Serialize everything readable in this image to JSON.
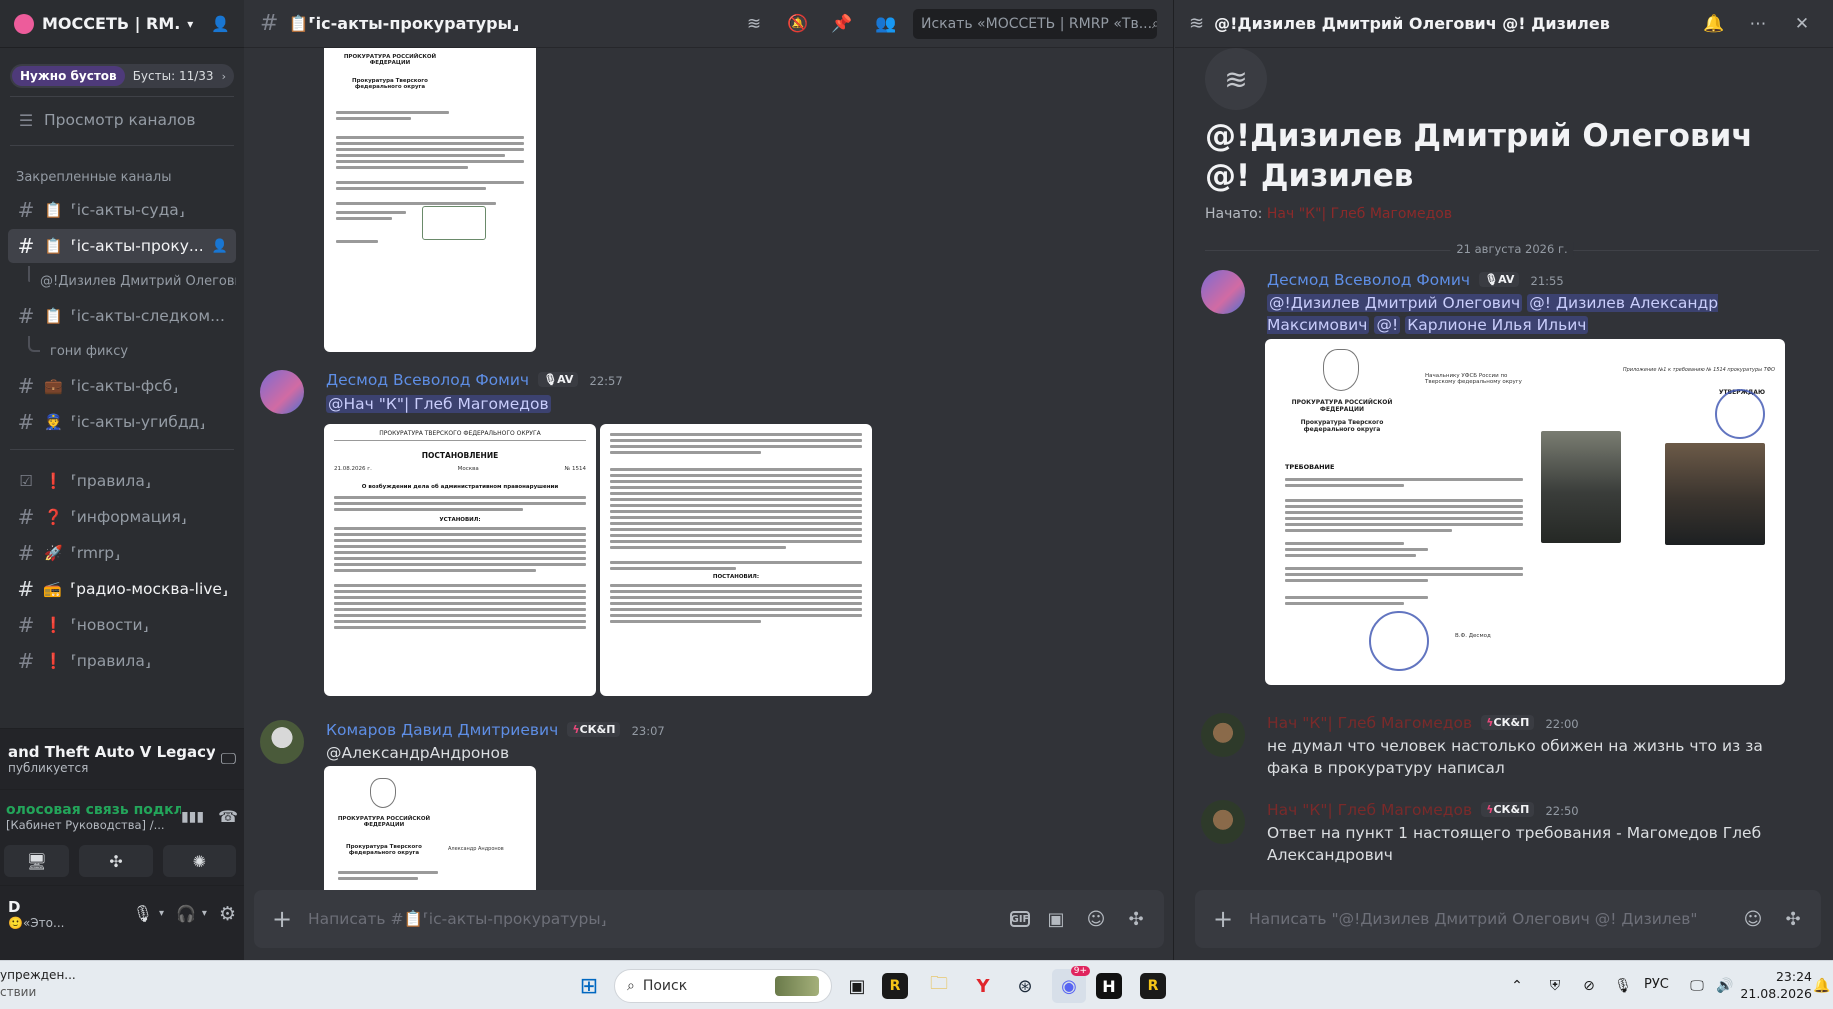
{
  "server": {
    "name": "МОССЕТЬ | RM...",
    "boost_pill": "Нужно бустов",
    "boost_count": "Бусты: 11/33",
    "browse_channels": "Просмотр каналов",
    "pinned_category": "Закрепленные каналы"
  },
  "channels": [
    {
      "label": "⸢іс-акты-суда⸥",
      "emoji": "📋"
    },
    {
      "label": "⸢іс-акты-проку...",
      "emoji": "📋"
    },
    {
      "label": "@!Дизилев Дмитрий Олегови"
    },
    {
      "label": "⸢іс-акты-следком...",
      "emoji": "📋"
    },
    {
      "label": "гони фиксу"
    },
    {
      "label": "⸢іс-акты-фсб⸥",
      "emoji": "💼"
    },
    {
      "label": "⸢іс-акты-угибдд⸥",
      "emoji": "👮"
    },
    {
      "label": "⸢правила⸥",
      "emoji": "❗"
    },
    {
      "label": "⸢информация⸥",
      "emoji": "❓"
    },
    {
      "label": "⸢rmrp⸥",
      "emoji": "🚀"
    },
    {
      "label": "⸢радио-москва-live⸥",
      "emoji": "📻"
    },
    {
      "label": "⸢новости⸥",
      "emoji": "❗"
    },
    {
      "label": "⸢правила⸥",
      "emoji": "❗"
    }
  ],
  "panel": {
    "game_title": "and Theft Auto V Legacy",
    "game_sub": "публикуется",
    "voice_title": "олосовая связь подкл",
    "voice_sub": "[Кабинет Руководства] /...",
    "user_name": "D",
    "user_status": "«Это..."
  },
  "main": {
    "channel_title": "📋⸢іс-акты-прокуратуры⸥",
    "search_placeholder": "Искать «МОССЕТЬ | RMRP «Тв...",
    "composer_placeholder": "Написать #📋⸢іс-акты-прокуратуры⸥",
    "messages": [
      {
        "author": "Десмод Всеволод Фомич",
        "tag": "AV",
        "time": "22:57",
        "mention": "@Нач \"К\"| Глеб Магомедов"
      },
      {
        "author": "Комаров Давид Дмитриевич",
        "tag": "СК&П",
        "time": "23:07",
        "text": "@АлександрАндронов"
      }
    ]
  },
  "thread": {
    "title": "@!Дизилев Дмитрий Олегович @! Дизилев",
    "big_title": "@!Дизилев Дмитрий Олегович @! Дизилев",
    "start_label": "Начато:",
    "start_user": "Нач \"К\"| Глеб Магомедов",
    "date_divider": "21 августа 2026 г.",
    "composer_placeholder": "Написать \"@!Дизилев Дмитрий Олегович @! Дизилев\"",
    "messages": [
      {
        "author": "Десмод Всеволод Фомич",
        "tag": "AV",
        "time": "21:55",
        "mentions": [
          "@!Дизилев Дмитрий Олегович",
          "@! Дизилев Александр Максимович",
          "@!",
          "Карлионе Илья Ильич"
        ]
      },
      {
        "author": "Нач \"К\"| Глеб Магомедов",
        "tag": "СК&П",
        "time": "22:00",
        "text": "не думал что человек настолько обижен на жизнь что из за фака в прокуратуру написал"
      },
      {
        "author": "Нач \"К\"| Глеб Магомедов",
        "tag": "СК&П",
        "time": "22:50",
        "text": "Ответ на пункт 1 настоящего требования - Магомедов Глеб Александрович"
      }
    ]
  },
  "docs": {
    "doc1_header": "ПРОКУРАТУРА РОССИЙСКОЙ ФЕДЕРАЦИИ",
    "doc1_sub": "Прокуратура Тверского федерального округа",
    "doc2_header": "ПРОКУРАТУРА ТВЕРСКОГО ФЕДЕРАЛЬНОГО ОКРУГА",
    "doc2_title": "ПОСТАНОВЛЕНИЕ",
    "doc2_date": "21.08.2026 г.",
    "doc2_city": "Москва",
    "doc2_num": "№ 1514",
    "doc2_subject": "О возбуждении дела об административном правонарушении",
    "doc2_established": "УСТАНОВИЛ:",
    "doc3_decided": "ПОСТАНОВИЛ:",
    "doc4_header": "ПРОКУРАТУРА РОССИЙСКОЙ ФЕДЕРАЦИИ",
    "doc4_sub": "Прокуратура Тверского федерального округа",
    "doc4_addressee": "Александр Андронов",
    "req_addressee": "Начальнику УФСБ России по Тверскому федеральному округу",
    "req_annex": "Приложение №1 к требованию № 1514 прокуратуры ТФО",
    "req_approve": "УТВЕРЖДАЮ",
    "req_title": "ТРЕБОВАНИЕ",
    "req_sign": "В.Ф. Десмод"
  },
  "taskbar": {
    "left_text1": "упрежден...",
    "left_text2": "ствии",
    "search": "Поиск",
    "lang": "РУС",
    "time": "23:24",
    "date": "21.08.2026",
    "discord_badge": "9+"
  }
}
